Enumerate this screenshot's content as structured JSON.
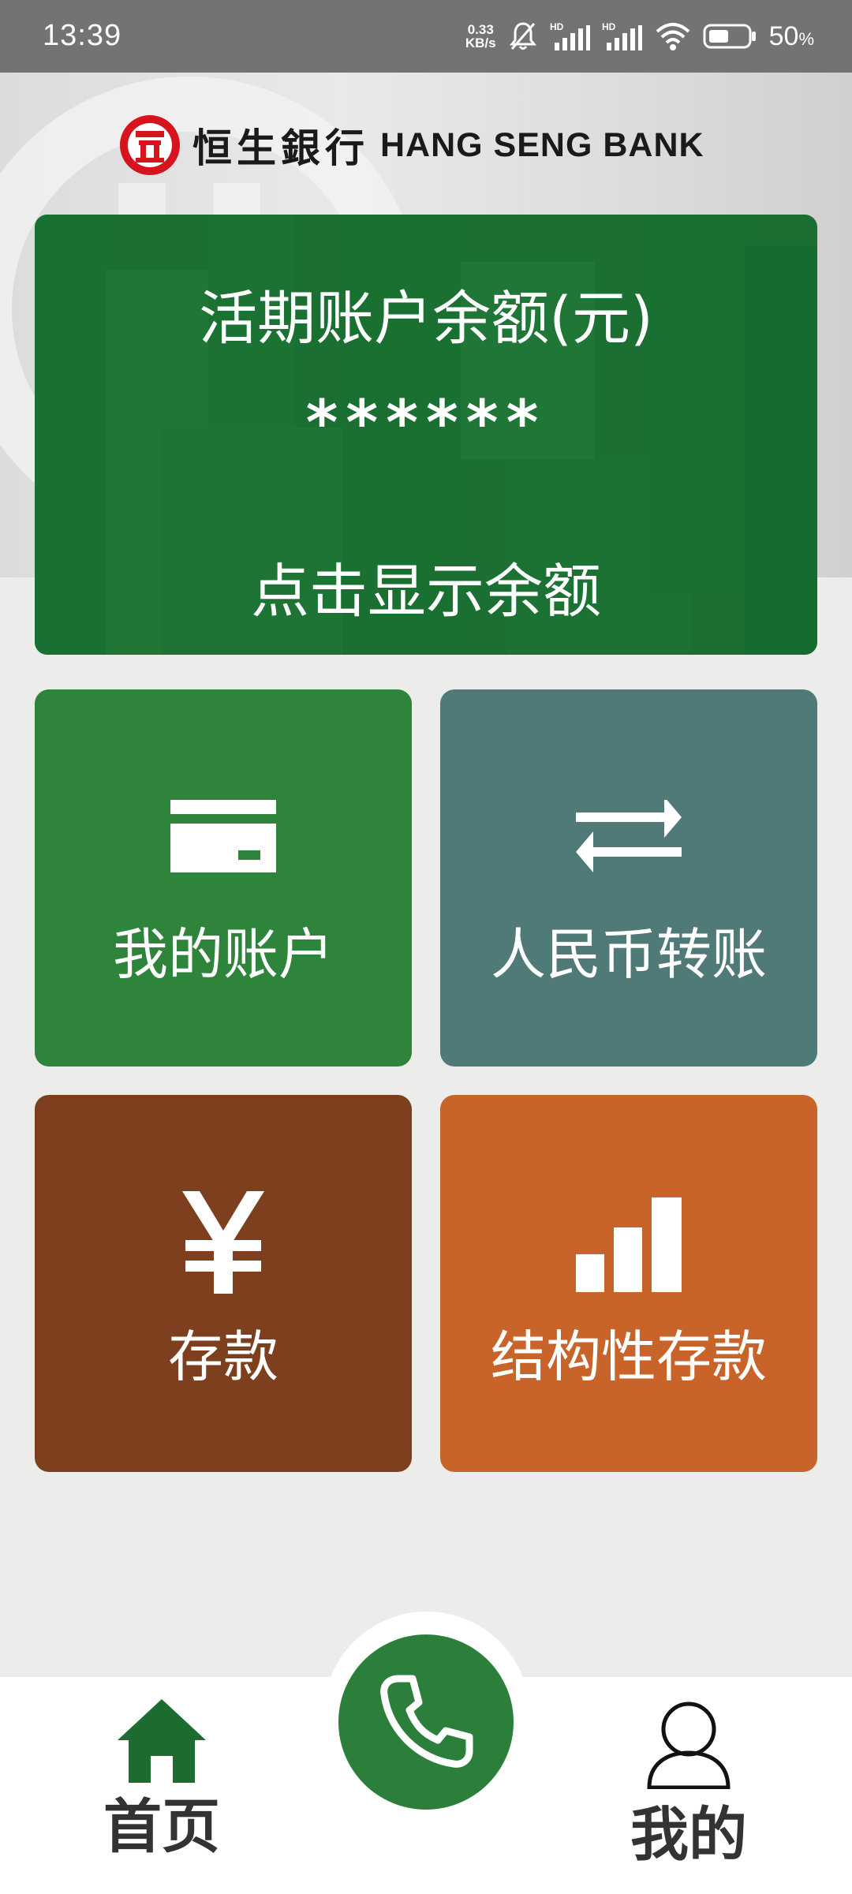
{
  "status_bar": {
    "time": "13:39",
    "net_speed_value": "0.33",
    "net_speed_unit": "KB/s",
    "battery_percent": "50",
    "battery_unit": "%",
    "icons": [
      "mute-bell-icon",
      "hd-signal-icon",
      "hd-signal-icon",
      "wifi-icon",
      "battery-icon"
    ]
  },
  "header": {
    "brand_cn": "恒生銀行",
    "brand_en": "HANG SENG BANK",
    "logo_icon": "hang-seng-logo"
  },
  "balance_card": {
    "title": "活期账户余额(元)",
    "masked_value": "******",
    "tap_text": "点击显示余额"
  },
  "tiles": [
    {
      "label": "我的账户",
      "icon": "card-icon",
      "color": "#2e843b"
    },
    {
      "label": "人民币转账",
      "icon": "transfer-arrows-icon",
      "color": "#4f7a78"
    },
    {
      "label": "存款",
      "icon": "yuan-icon",
      "color": "#7e3f1e"
    },
    {
      "label": "结构性存款",
      "icon": "bar-chart-icon",
      "color": "#c8642a"
    }
  ],
  "bottom_nav": {
    "home_label": "首页",
    "mine_label": "我的",
    "call_icon": "phone-icon"
  },
  "colors": {
    "brand_green": "#1b6f33",
    "status_bar": "#737373",
    "logo_red": "#d7141e"
  }
}
